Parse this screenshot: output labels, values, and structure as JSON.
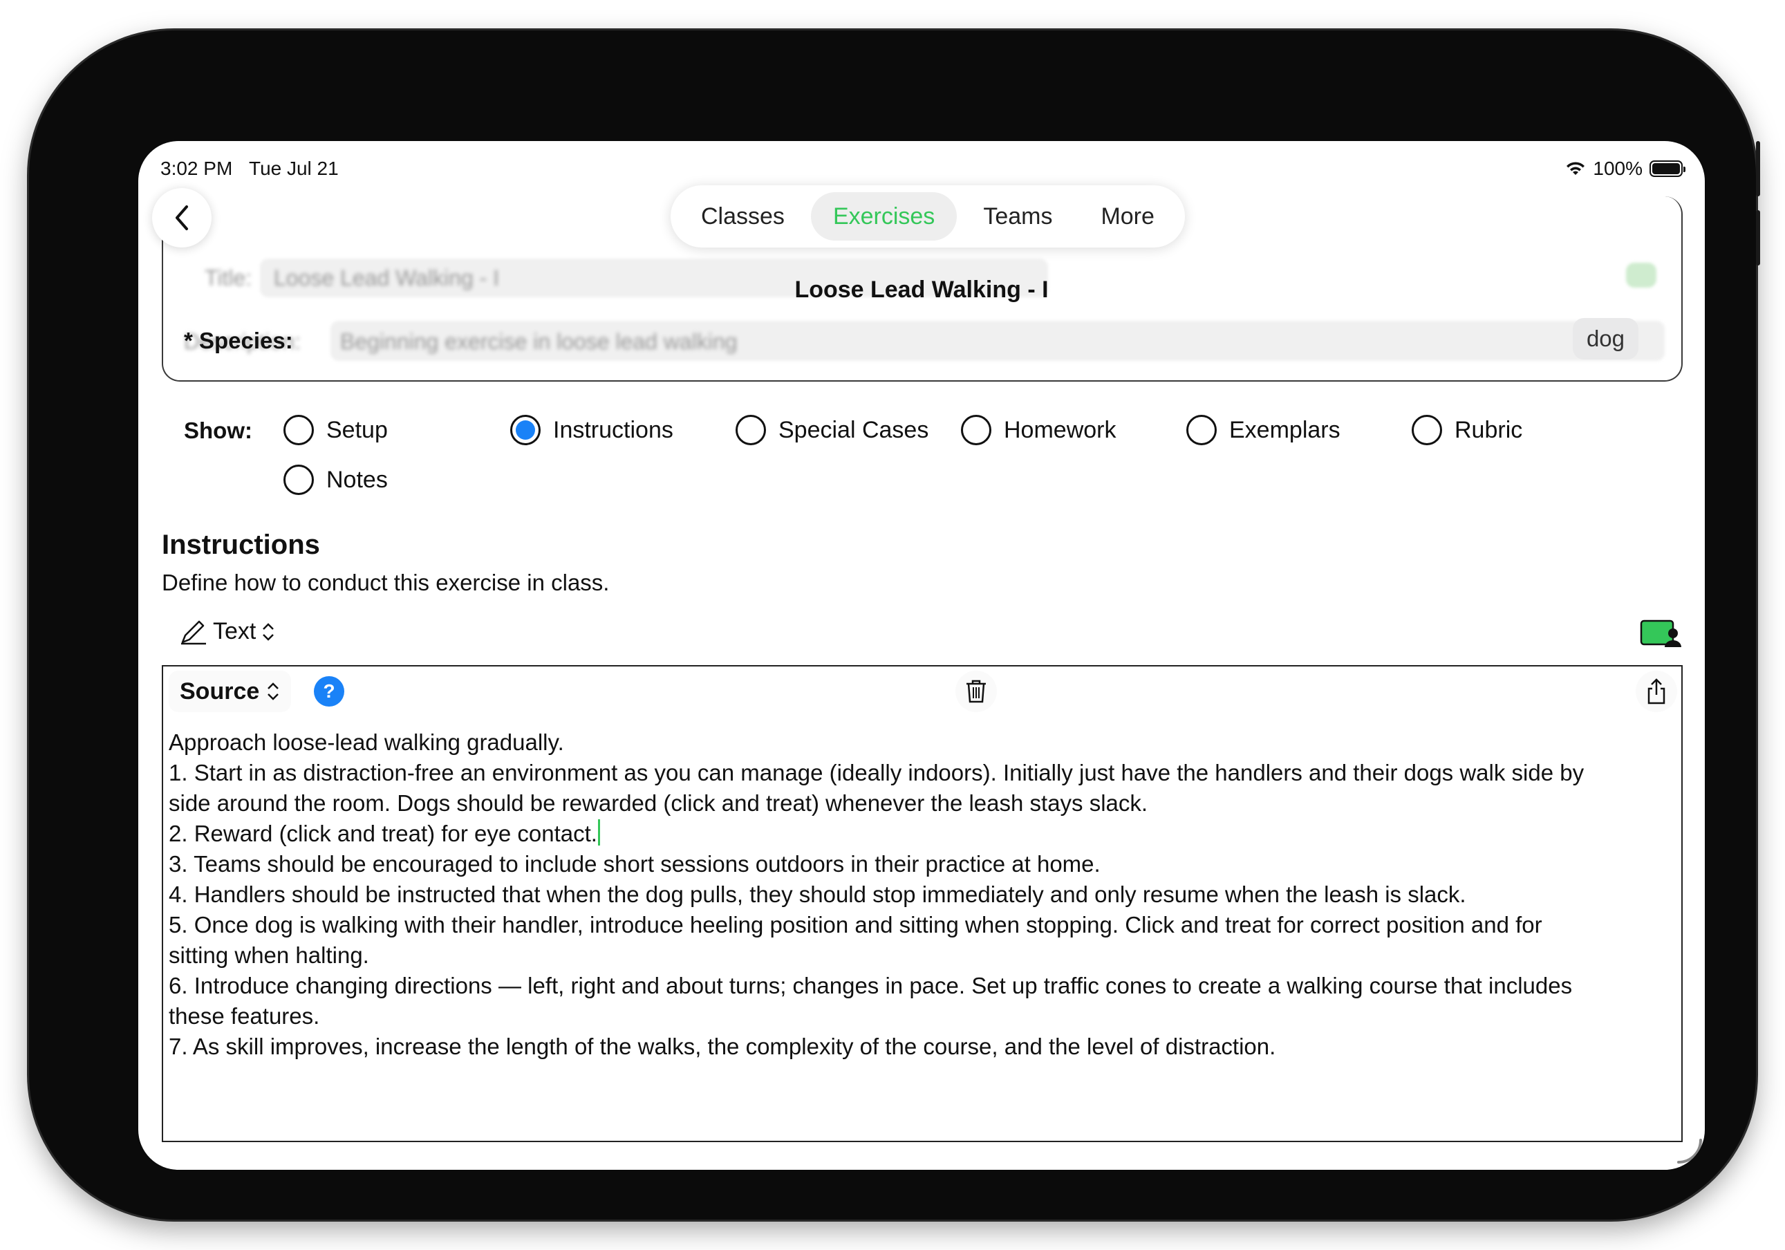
{
  "status_bar": {
    "time": "3:02 PM",
    "date": "Tue Jul 21",
    "battery": "100%"
  },
  "nav": {
    "tabs": [
      {
        "label": "Classes"
      },
      {
        "label": "Exercises"
      },
      {
        "label": "Teams"
      },
      {
        "label": "More"
      }
    ],
    "active_tab": "Exercises"
  },
  "form": {
    "title_label": "Title:",
    "title_value": "Loose Lead Walking - I",
    "description_label": "Description:",
    "description_value": "Beginning exercise in loose lead walking",
    "species_label": "* Species:",
    "species_value": "dog"
  },
  "document_title": "Loose Lead Walking - I",
  "show": {
    "label": "Show:",
    "options": [
      {
        "label": "Setup",
        "selected": false
      },
      {
        "label": "Instructions",
        "selected": true
      },
      {
        "label": "Special Cases",
        "selected": false
      },
      {
        "label": "Homework",
        "selected": false
      },
      {
        "label": "Exemplars",
        "selected": false
      },
      {
        "label": "Rubric",
        "selected": false
      },
      {
        "label": "Notes",
        "selected": false
      }
    ]
  },
  "section": {
    "title": "Instructions",
    "description": "Define how to conduct this exercise in class."
  },
  "mode_selector": {
    "label": "Text"
  },
  "editor": {
    "source_label": "Source",
    "help_label": "?",
    "lines": [
      "Approach loose-lead walking gradually.",
      "1. Start in as distraction-free an environment as you can manage (ideally indoors). Initially just have the handlers and their dogs walk side by",
      "side around the room. Dogs should be rewarded (click and treat) whenever the leash stays slack.",
      "2. Reward (click and treat) for eye contact.",
      "3. Teams should be encouraged to include short sessions outdoors in their practice at home.",
      "4. Handlers should be instructed that when the dog pulls, they should stop immediately and only resume when the leash is slack.",
      "5. Once dog is walking with their handler, introduce heeling position and sitting when stopping. Click and treat for correct position and for",
      "sitting when halting.",
      "6. Introduce changing directions — left, right and about turns; changes in pace. Set up traffic cones to create a walking course that includes",
      "these features.",
      "7. As skill improves, increase the length of the walks, the complexity of the course, and the level of distraction."
    ]
  },
  "colors": {
    "accent_green": "#34c759",
    "radio_blue": "#1a82f7",
    "help_blue": "#1a82f7"
  },
  "icons": [
    "back-chevron-icon",
    "wifi-icon",
    "battery-icon",
    "pencil-icon",
    "chevron-updown-icon",
    "person-screen-icon",
    "help-icon",
    "trash-icon",
    "share-icon",
    "resize-handle-icon"
  ]
}
